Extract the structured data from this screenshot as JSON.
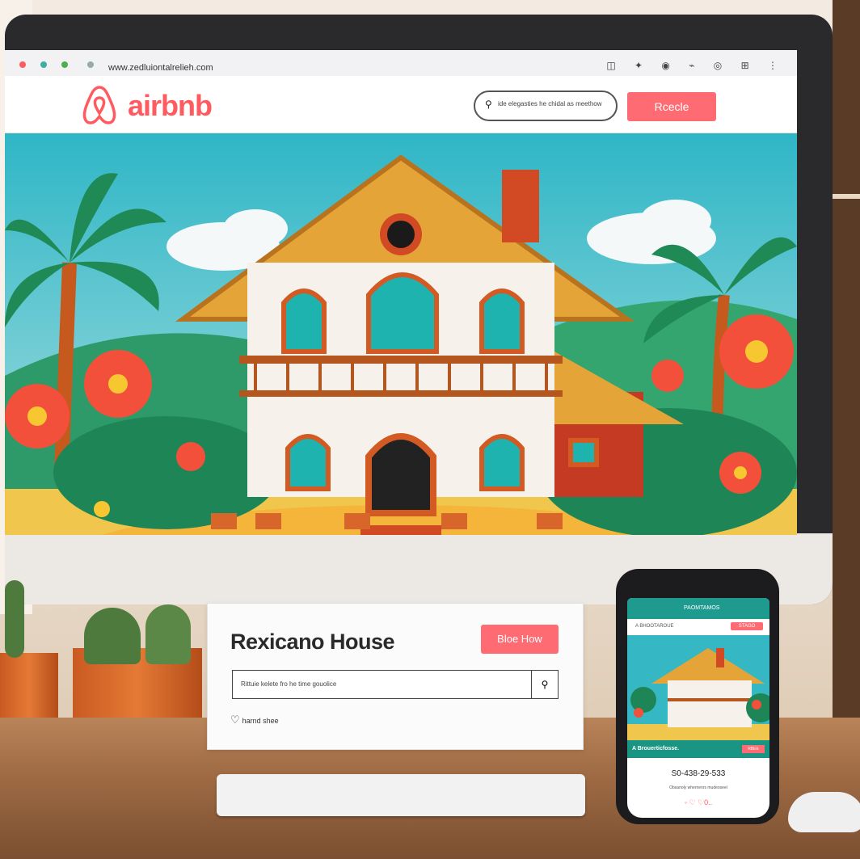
{
  "browser": {
    "url": "www.zedluiontalrelieh.com",
    "toolbar_icons": "◫ ✦ ◉ ⌁ ◎ ⊞ ⋮"
  },
  "site": {
    "brand_name": "airbnb",
    "brand_color": "#ff5a5f",
    "search_placeholder": "ide elegasties he chidal as meethow",
    "nav_button": "Rcecle"
  },
  "listing_card": {
    "title": "Rexicano House",
    "book_button": "Bloe How",
    "input_placeholder": "Rittuie kelete fro he time gouolice",
    "favorite_label": "harnd shee"
  },
  "phone": {
    "top_title": "PAOMTAMOS",
    "sub_label": "A BHOOTAROUE",
    "sub_button": "STAGO",
    "band_title": "A Brouerticfosse.",
    "band_button": "RBEE",
    "number": "S0-438-29-533",
    "description": "Obsanoly whernenrs mudeoseel",
    "icons": "◦ ♡ ♡0.."
  }
}
